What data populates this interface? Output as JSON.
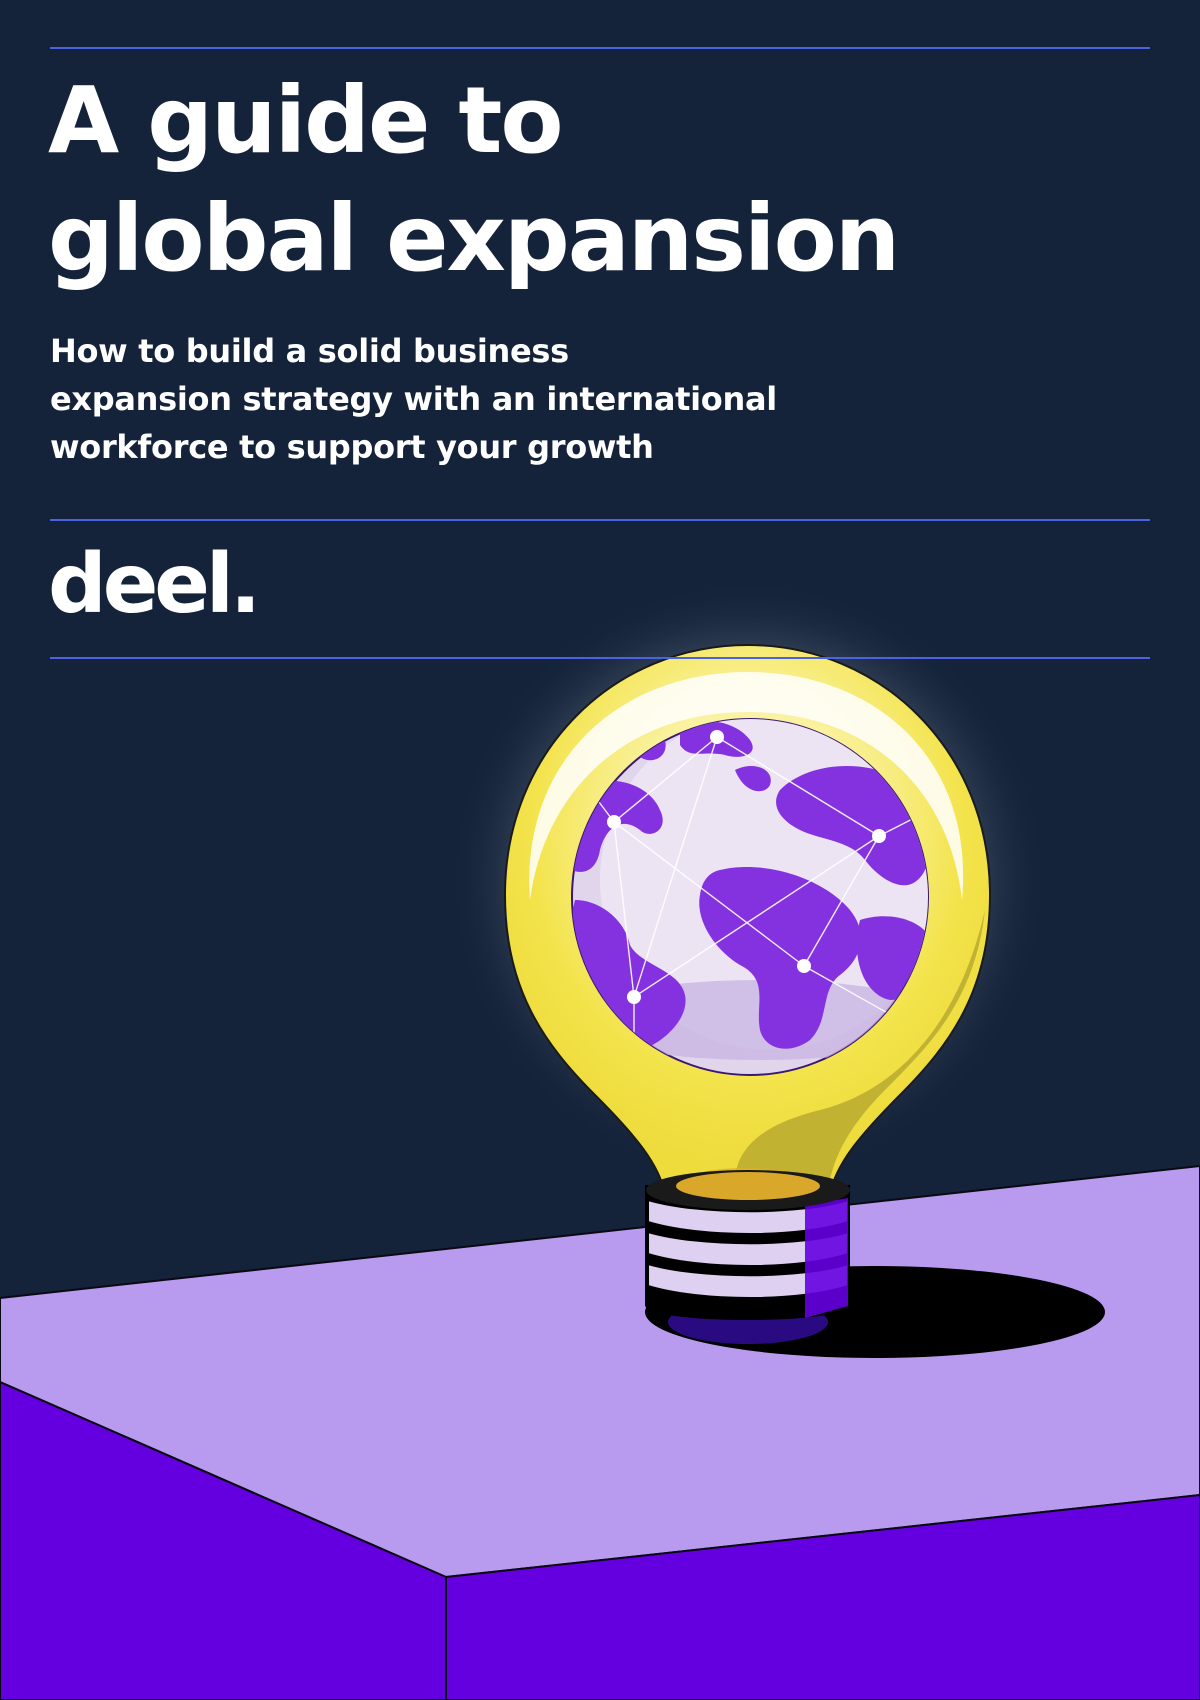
{
  "cover": {
    "title_line_1": "A guide to",
    "title_line_2": "global expansion",
    "subtitle_line_1": "How to build a solid business",
    "subtitle_line_2": "expansion strategy with an international",
    "subtitle_line_3": "workforce to support your growth"
  },
  "brand": {
    "logo_text": "deel."
  },
  "illustration": {
    "subject": "light-bulb-with-globe-icon"
  },
  "colors": {
    "background": "#14233a",
    "rule": "#4a63e0",
    "text": "#ffffff",
    "table_top": "#b89aee",
    "table_side": "#6400e0",
    "bulb_yellow": "#f3e34a",
    "globe_land": "#8432e0",
    "globe_sea": "#e1d5ec"
  }
}
